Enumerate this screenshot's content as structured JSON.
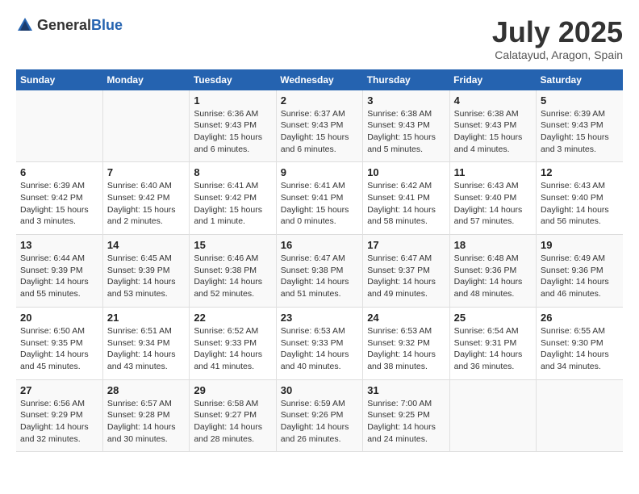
{
  "logo": {
    "general": "General",
    "blue": "Blue"
  },
  "header": {
    "month": "July 2025",
    "location": "Calatayud, Aragon, Spain"
  },
  "weekdays": [
    "Sunday",
    "Monday",
    "Tuesday",
    "Wednesday",
    "Thursday",
    "Friday",
    "Saturday"
  ],
  "weeks": [
    [
      {
        "day": "",
        "info": ""
      },
      {
        "day": "",
        "info": ""
      },
      {
        "day": "1",
        "info": "Sunrise: 6:36 AM\nSunset: 9:43 PM\nDaylight: 15 hours and 6 minutes."
      },
      {
        "day": "2",
        "info": "Sunrise: 6:37 AM\nSunset: 9:43 PM\nDaylight: 15 hours and 6 minutes."
      },
      {
        "day": "3",
        "info": "Sunrise: 6:38 AM\nSunset: 9:43 PM\nDaylight: 15 hours and 5 minutes."
      },
      {
        "day": "4",
        "info": "Sunrise: 6:38 AM\nSunset: 9:43 PM\nDaylight: 15 hours and 4 minutes."
      },
      {
        "day": "5",
        "info": "Sunrise: 6:39 AM\nSunset: 9:43 PM\nDaylight: 15 hours and 3 minutes."
      }
    ],
    [
      {
        "day": "6",
        "info": "Sunrise: 6:39 AM\nSunset: 9:42 PM\nDaylight: 15 hours and 3 minutes."
      },
      {
        "day": "7",
        "info": "Sunrise: 6:40 AM\nSunset: 9:42 PM\nDaylight: 15 hours and 2 minutes."
      },
      {
        "day": "8",
        "info": "Sunrise: 6:41 AM\nSunset: 9:42 PM\nDaylight: 15 hours and 1 minute."
      },
      {
        "day": "9",
        "info": "Sunrise: 6:41 AM\nSunset: 9:41 PM\nDaylight: 15 hours and 0 minutes."
      },
      {
        "day": "10",
        "info": "Sunrise: 6:42 AM\nSunset: 9:41 PM\nDaylight: 14 hours and 58 minutes."
      },
      {
        "day": "11",
        "info": "Sunrise: 6:43 AM\nSunset: 9:40 PM\nDaylight: 14 hours and 57 minutes."
      },
      {
        "day": "12",
        "info": "Sunrise: 6:43 AM\nSunset: 9:40 PM\nDaylight: 14 hours and 56 minutes."
      }
    ],
    [
      {
        "day": "13",
        "info": "Sunrise: 6:44 AM\nSunset: 9:39 PM\nDaylight: 14 hours and 55 minutes."
      },
      {
        "day": "14",
        "info": "Sunrise: 6:45 AM\nSunset: 9:39 PM\nDaylight: 14 hours and 53 minutes."
      },
      {
        "day": "15",
        "info": "Sunrise: 6:46 AM\nSunset: 9:38 PM\nDaylight: 14 hours and 52 minutes."
      },
      {
        "day": "16",
        "info": "Sunrise: 6:47 AM\nSunset: 9:38 PM\nDaylight: 14 hours and 51 minutes."
      },
      {
        "day": "17",
        "info": "Sunrise: 6:47 AM\nSunset: 9:37 PM\nDaylight: 14 hours and 49 minutes."
      },
      {
        "day": "18",
        "info": "Sunrise: 6:48 AM\nSunset: 9:36 PM\nDaylight: 14 hours and 48 minutes."
      },
      {
        "day": "19",
        "info": "Sunrise: 6:49 AM\nSunset: 9:36 PM\nDaylight: 14 hours and 46 minutes."
      }
    ],
    [
      {
        "day": "20",
        "info": "Sunrise: 6:50 AM\nSunset: 9:35 PM\nDaylight: 14 hours and 45 minutes."
      },
      {
        "day": "21",
        "info": "Sunrise: 6:51 AM\nSunset: 9:34 PM\nDaylight: 14 hours and 43 minutes."
      },
      {
        "day": "22",
        "info": "Sunrise: 6:52 AM\nSunset: 9:33 PM\nDaylight: 14 hours and 41 minutes."
      },
      {
        "day": "23",
        "info": "Sunrise: 6:53 AM\nSunset: 9:33 PM\nDaylight: 14 hours and 40 minutes."
      },
      {
        "day": "24",
        "info": "Sunrise: 6:53 AM\nSunset: 9:32 PM\nDaylight: 14 hours and 38 minutes."
      },
      {
        "day": "25",
        "info": "Sunrise: 6:54 AM\nSunset: 9:31 PM\nDaylight: 14 hours and 36 minutes."
      },
      {
        "day": "26",
        "info": "Sunrise: 6:55 AM\nSunset: 9:30 PM\nDaylight: 14 hours and 34 minutes."
      }
    ],
    [
      {
        "day": "27",
        "info": "Sunrise: 6:56 AM\nSunset: 9:29 PM\nDaylight: 14 hours and 32 minutes."
      },
      {
        "day": "28",
        "info": "Sunrise: 6:57 AM\nSunset: 9:28 PM\nDaylight: 14 hours and 30 minutes."
      },
      {
        "day": "29",
        "info": "Sunrise: 6:58 AM\nSunset: 9:27 PM\nDaylight: 14 hours and 28 minutes."
      },
      {
        "day": "30",
        "info": "Sunrise: 6:59 AM\nSunset: 9:26 PM\nDaylight: 14 hours and 26 minutes."
      },
      {
        "day": "31",
        "info": "Sunrise: 7:00 AM\nSunset: 9:25 PM\nDaylight: 14 hours and 24 minutes."
      },
      {
        "day": "",
        "info": ""
      },
      {
        "day": "",
        "info": ""
      }
    ]
  ]
}
